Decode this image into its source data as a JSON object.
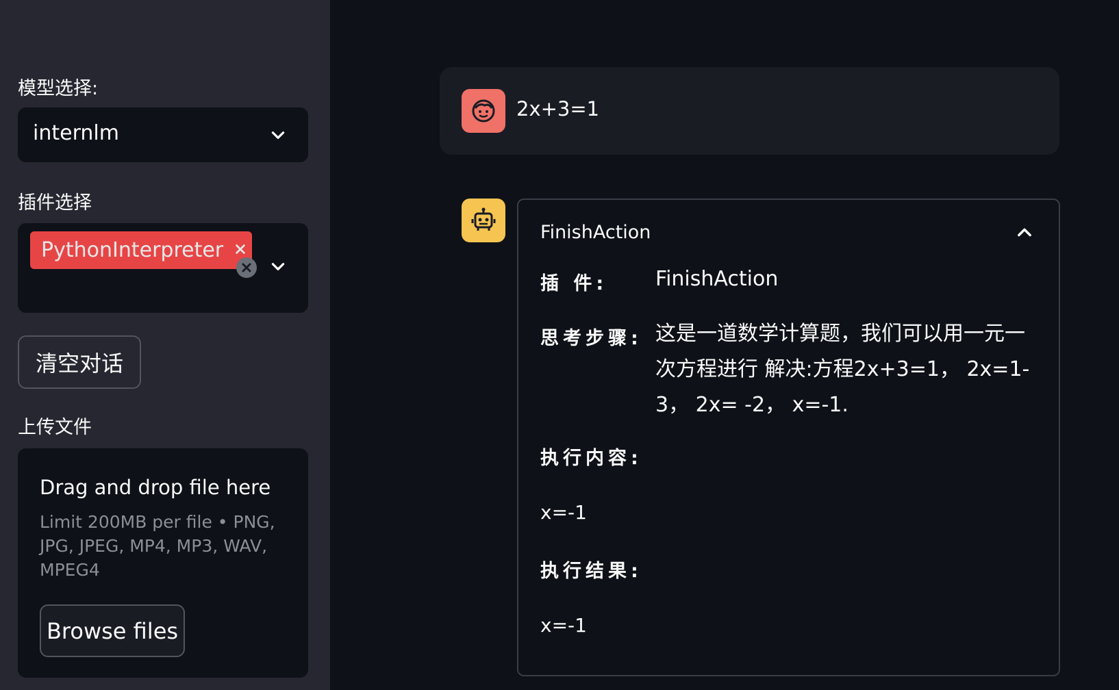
{
  "sidebar": {
    "model_label": "模型选择:",
    "model_value": "internlm",
    "plugin_label": "插件选择",
    "plugin_tag": "PythonInterpreter",
    "clear_button": "清空对话",
    "upload_label": "上传文件",
    "dropzone_title": "Drag and drop file here",
    "dropzone_limit": "Limit 200MB per file • PNG, JPG, JPEG, MP4, MP3, WAV, MPEG4",
    "browse_button": "Browse files"
  },
  "chat": {
    "user_message": "2x+3=1",
    "assistant": {
      "expander_title": "FinishAction",
      "plugin_label": "插 件:",
      "plugin_value": "FinishAction",
      "thought_label": "思考步骤:",
      "thought_value": "这是一道数学计算题，我们可以用一元一次方程进行 解决:方程2x+3=1， 2x=1-3， 2x= -2， x=-1.",
      "exec_content_label": "执行内容:",
      "exec_content_value": "x=-1",
      "exec_result_label": "执行结果:",
      "exec_result_value": "x=-1"
    }
  },
  "colors": {
    "accent_red": "#ff4b4b",
    "user_avatar": "#f07167",
    "assistant_avatar": "#f5c451",
    "sidebar_bg": "#262730",
    "main_bg": "#0e1117"
  },
  "icons": {
    "select_chevron": "chevron-down-icon",
    "tag_remove": "close-icon",
    "clear_all": "clear-circle-icon",
    "user_avatar": "user-face-icon",
    "assistant_avatar": "robot-icon",
    "expander": "chevron-up-icon"
  }
}
